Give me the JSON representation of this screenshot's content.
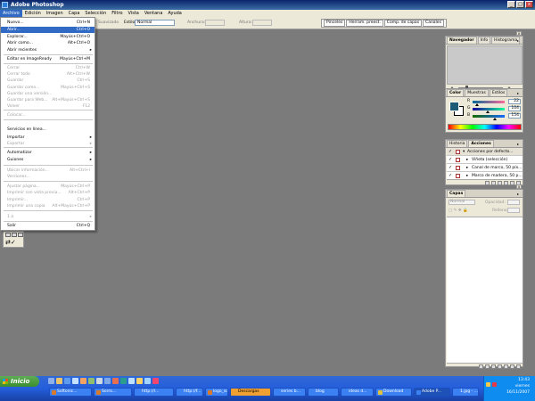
{
  "window": {
    "title": "Adobe Photoshop",
    "buttons": [
      "_",
      "□",
      "x"
    ]
  },
  "menubar": [
    "Archivo",
    "Edición",
    "Imagen",
    "Capa",
    "Selección",
    "Filtro",
    "Vista",
    "Ventana",
    "Ayuda"
  ],
  "options_bar": {
    "label_suavizado": "Suavizado",
    "label_estilo": "Estilo:",
    "estilo_value": "Normal",
    "label_anchura": "Anchura:",
    "label_altura": "Altura:",
    "well_tabs": [
      "Pinceles",
      "Herram. preest.",
      "Comp. de capas",
      "Canales"
    ]
  },
  "file_menu": {
    "items": [
      {
        "label": "Nuevo...",
        "shortcut": "Ctrl+N",
        "enabled": true
      },
      {
        "label": "Abrir...",
        "shortcut": "Ctrl+O",
        "enabled": true,
        "highlighted": true
      },
      {
        "label": "Explorar...",
        "shortcut": "Mayús+Ctrl+O",
        "enabled": true
      },
      {
        "label": "Abrir como...",
        "shortcut": "Alt+Ctrl+O",
        "enabled": true
      },
      {
        "label": "Abrir recientes",
        "shortcut": "",
        "enabled": true,
        "submenu": true
      },
      {
        "label": "Editar en ImageReady",
        "shortcut": "Mayús+Ctrl+M",
        "enabled": true
      },
      {
        "label": "Cerrar",
        "shortcut": "Ctrl+W",
        "enabled": false
      },
      {
        "label": "Cerrar todo",
        "shortcut": "Alt+Ctrl+W",
        "enabled": false
      },
      {
        "label": "Guardar",
        "shortcut": "Ctrl+S",
        "enabled": false
      },
      {
        "label": "Guardar como...",
        "shortcut": "Mayús+Ctrl+S",
        "enabled": false
      },
      {
        "label": "Guardar una versión...",
        "shortcut": "",
        "enabled": false
      },
      {
        "label": "Guardar para Web...",
        "shortcut": "Alt+Mayús+Ctrl+S",
        "enabled": false
      },
      {
        "label": "Volver",
        "shortcut": "F12",
        "enabled": false
      },
      {
        "label": "Colocar...",
        "shortcut": "",
        "enabled": false
      },
      {
        "label": "Servicios en línea...",
        "shortcut": "",
        "enabled": true
      },
      {
        "label": "Importar",
        "shortcut": "",
        "enabled": true,
        "submenu": true
      },
      {
        "label": "Exportar",
        "shortcut": "",
        "enabled": false,
        "submenu": true
      },
      {
        "label": "Automatizar",
        "shortcut": "",
        "enabled": true,
        "submenu": true
      },
      {
        "label": "Guiones",
        "shortcut": "",
        "enabled": true,
        "submenu": true
      },
      {
        "label": "Ubicar información...",
        "shortcut": "Alt+Ctrl+I",
        "enabled": false
      },
      {
        "label": "Versiones...",
        "shortcut": "",
        "enabled": false
      },
      {
        "label": "Ajustar página...",
        "shortcut": "Mayús+Ctrl+P",
        "enabled": false
      },
      {
        "label": "Imprimir con vista previa...",
        "shortcut": "Alt+Ctrl+P",
        "enabled": false
      },
      {
        "label": "Imprimir...",
        "shortcut": "Ctrl+P",
        "enabled": false
      },
      {
        "label": "Imprimir una copia",
        "shortcut": "Alt+Mayús+Ctrl+P",
        "enabled": false
      },
      {
        "label": "1 a",
        "shortcut": "",
        "enabled": false,
        "submenu": true
      },
      {
        "label": "Salir",
        "shortcut": "Ctrl+Q",
        "enabled": true
      }
    ]
  },
  "navigator": {
    "tabs": [
      "Navegador",
      "Info",
      "Histograma"
    ]
  },
  "color": {
    "tabs": [
      "Color",
      "Muestras",
      "Estilos"
    ],
    "foreground": "#1d5a75",
    "channels": [
      {
        "name": "R",
        "value": "22"
      },
      {
        "name": "G",
        "value": "104"
      },
      {
        "name": "B",
        "value": "154"
      }
    ]
  },
  "actions": {
    "tabs": [
      "Historia",
      "Acciones"
    ],
    "rows": [
      {
        "label": "Acciones por defecto...",
        "group": true,
        "check": "✓"
      },
      {
        "label": "Viñeta (selección)",
        "group": false,
        "check": "✓"
      },
      {
        "label": "Canal de marco, 50 píx...",
        "group": false,
        "check": "✓"
      },
      {
        "label": "Marco de madera, 50 p...",
        "group": false,
        "check": "✓"
      }
    ]
  },
  "layers": {
    "tabs": [
      "Capas"
    ],
    "blend_mode": "Normal",
    "opacity_label": "Opacidad:",
    "fill_label": "Relleno:"
  },
  "taskbar": {
    "start_label": "Inicio",
    "buttons": [
      {
        "label": "Softonic...",
        "color": "#d87a2a"
      },
      {
        "label": "Sorro...",
        "color": "#d87a2a"
      },
      {
        "label": "http://l...",
        "color": "#3c81f3"
      },
      {
        "label": "http://f...",
        "color": "#3c81f3"
      },
      {
        "label": "logo_so...",
        "color": "#d87a2a"
      },
      {
        "label": "Descargas",
        "color": "#f0a030"
      },
      {
        "label": "series b...",
        "color": "#3c81f3"
      },
      {
        "label": "blog",
        "color": "#3c81f3"
      },
      {
        "label": "ideas d...",
        "color": "#3c81f3"
      },
      {
        "label": "Download",
        "color": "#e0c040"
      },
      {
        "label": "Adobe P...",
        "color": "#3c81f3"
      },
      {
        "label": "1.jpg - ...",
        "color": "#3c81f3"
      }
    ],
    "clock_time": "13:43",
    "clock_day": "viernes",
    "clock_date": "16/11/2007"
  }
}
